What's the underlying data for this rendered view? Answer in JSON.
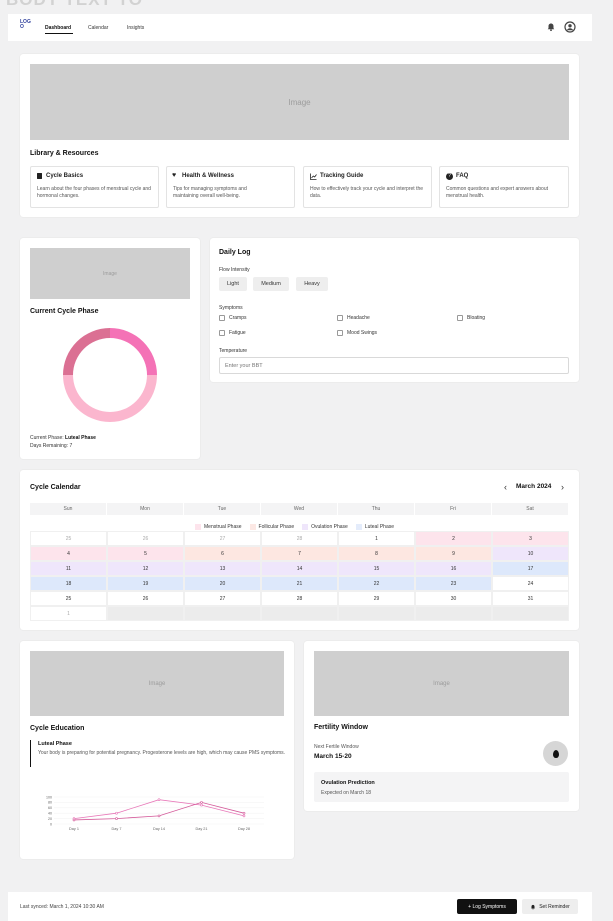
{
  "bg_title": "BODY TEXT TO",
  "nav": {
    "logo": "LOGO",
    "tabs": [
      {
        "label": "Dashboard",
        "active": true
      },
      {
        "label": "Calendar",
        "active": false
      },
      {
        "label": "Insights",
        "active": false
      }
    ]
  },
  "hero": {
    "image_label": "Image",
    "heading": "Library & Resources",
    "resources": [
      {
        "icon": "book-icon",
        "title": "Cycle Basics",
        "desc": "Learn about the four phases of menstrual cycle and hormonal changes."
      },
      {
        "icon": "heart-icon",
        "title": "Health & Wellness",
        "desc": "Tips for managing symptoms and maintaining overall well-being."
      },
      {
        "icon": "chart-icon",
        "title": "Tracking Guide",
        "desc": "How to effectively track your cycle and interpret the data."
      },
      {
        "icon": "question-icon",
        "title": "FAQ",
        "desc": "Common questions and expert answers about menstrual health."
      }
    ]
  },
  "phase_card": {
    "image_label": "Image",
    "heading": "Current Cycle Phase",
    "current_label": "Current Phase:",
    "current_value": "Luteal Phase",
    "days_label": "Days Remaining:",
    "days_value": "7",
    "donut_colors": [
      "#f472b6",
      "#fbb6ce",
      "#fbb6ce",
      "#db7093"
    ],
    "donut_values": [
      25,
      25,
      25,
      25
    ]
  },
  "daily_log": {
    "heading": "Daily Log",
    "flow_label": "Flow Intensity",
    "flow_options": [
      "Light",
      "Medium",
      "Heavy"
    ],
    "symptoms_label": "Symptoms",
    "symptoms": [
      "Cramps",
      "Headache",
      "Bloating",
      "Fatigue",
      "Mood Swings"
    ],
    "temp_label": "Temperature",
    "temp_placeholder": "Enter your BBT"
  },
  "calendar": {
    "heading": "Cycle Calendar",
    "month": "March 2024",
    "prev": "‹",
    "next": "›",
    "weekdays": [
      "Sun",
      "Mon",
      "Tue",
      "Wed",
      "Thu",
      "Fri",
      "Sat"
    ],
    "legend": [
      {
        "label": "Menstrual Phase",
        "color": "#fde4ec"
      },
      {
        "label": "Follicular Phase",
        "color": "#fce8e4"
      },
      {
        "label": "Ovulation Phase",
        "color": "#efe6fb"
      },
      {
        "label": "Luteal Phase",
        "color": "#e4ecfb"
      }
    ],
    "colors": {
      "m": "#fde4ec",
      "f": "#fde7e1",
      "o": "#efe6fb",
      "l": "#dde8fb",
      "w": "#ffffff",
      "x": "#ffffff",
      "g": "#ececec"
    },
    "rows": [
      [
        [
          "25",
          "x"
        ],
        [
          "26",
          "x"
        ],
        [
          "27",
          "x"
        ],
        [
          "28",
          "x"
        ],
        [
          "1",
          "w"
        ],
        [
          "2",
          "m"
        ],
        [
          "3",
          "m"
        ]
      ],
      [
        [
          "4",
          "m"
        ],
        [
          "5",
          "m"
        ],
        [
          "6",
          "f"
        ],
        [
          "7",
          "f"
        ],
        [
          "8",
          "f"
        ],
        [
          "9",
          "f"
        ],
        [
          "10",
          "o"
        ]
      ],
      [
        [
          "11",
          "o"
        ],
        [
          "12",
          "o"
        ],
        [
          "13",
          "o"
        ],
        [
          "14",
          "o"
        ],
        [
          "15",
          "o"
        ],
        [
          "16",
          "o"
        ],
        [
          "17",
          "l"
        ]
      ],
      [
        [
          "18",
          "l"
        ],
        [
          "19",
          "l"
        ],
        [
          "20",
          "l"
        ],
        [
          "21",
          "l"
        ],
        [
          "22",
          "l"
        ],
        [
          "23",
          "l"
        ],
        [
          "24",
          "w"
        ]
      ],
      [
        [
          "25",
          "w"
        ],
        [
          "26",
          "w"
        ],
        [
          "27",
          "w"
        ],
        [
          "28",
          "w"
        ],
        [
          "29",
          "w"
        ],
        [
          "30",
          "w"
        ],
        [
          "31",
          "w"
        ]
      ],
      [
        [
          "1",
          "x"
        ],
        [
          "",
          "g"
        ],
        [
          "",
          "g"
        ],
        [
          "",
          "g"
        ],
        [
          "",
          "g"
        ],
        [
          "",
          "g"
        ],
        [
          "",
          "g"
        ]
      ]
    ]
  },
  "education": {
    "image_label": "Image",
    "heading": "Cycle Education",
    "phase_title": "Luteal Phase",
    "phase_desc": "Your body is preparing for potential pregnancy. Progesterone levels are high, which may cause PMS symptoms.",
    "chart_data": {
      "type": "line",
      "x": [
        "Day 1",
        "Day 7",
        "Day 14",
        "Day 21",
        "Day 28"
      ],
      "yticks": [
        0,
        20,
        40,
        60,
        80,
        100
      ],
      "ylim": [
        0,
        100
      ],
      "series": [
        {
          "values": [
            20,
            40,
            90,
            70,
            30
          ],
          "color": "#e879b9"
        },
        {
          "values": [
            15,
            20,
            30,
            80,
            40
          ],
          "color": "#d45a9a"
        }
      ]
    }
  },
  "fertility": {
    "image_label": "Image",
    "heading": "Fertility Window",
    "next_label": "Next Fertile Window",
    "next_value": "March 15-20",
    "ovulation_label": "Ovulation Prediction",
    "ovulation_value": "Expected on March 18"
  },
  "footer": {
    "synced": "Last synced: March 1, 2024 10:30 AM",
    "log_button": "+  Log Symptoms",
    "reminder_button": "Set Reminder"
  }
}
